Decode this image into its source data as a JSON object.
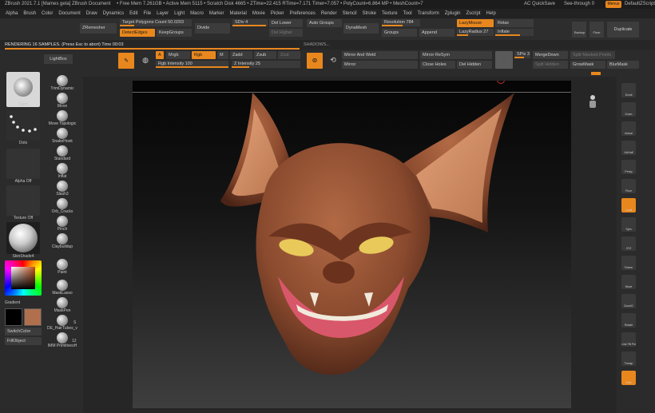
{
  "titlebar": {
    "app": "ZBrush 2021.7.1 [Mames geta]   ZBrush Document",
    "stats": "• Free Mem 7.261GB • Active Mem 5115 • Scratch Disk 4665 • ZTime=22.415 RTime=7.171 Timer=7.057 • PolyCount=6.864 MP • MeshCount=7",
    "ac": "AC",
    "quicksave": "QuickSave",
    "seethrough": "See-through  0",
    "menus": "Menus",
    "defaultscript": "DefaultZScript"
  },
  "menubar": [
    "Alpha",
    "Brush",
    "Color",
    "Document",
    "Draw",
    "Dynamics",
    "Edit",
    "File",
    "Layer",
    "Light",
    "Macro",
    "Marker",
    "Material",
    "Movie",
    "Picker",
    "Preferences",
    "Render",
    "Stencil",
    "Stroke",
    "Texture",
    "Tool",
    "Transform",
    "Zplugin",
    "Zscript",
    "Help"
  ],
  "toppalette": {
    "zremesher": "ZRemesher",
    "target_polys": "Target Polygons Count 50.0203",
    "detect_edges": "DetectEdges",
    "keep_groups": "KeepGroups",
    "divide": "Divide",
    "sdiv": "SDiv 4",
    "del_lower": "Del Lower",
    "del_higher": "Del Higher",
    "auto_groups": "Auto Groups",
    "dynamesh": "DynaMesh",
    "resolution": "Resolution 784",
    "groups": "Groups",
    "append": "Append",
    "lazymouse": "LazyMouse",
    "lazyradius": "LazyRadius 27",
    "relax": "Relax",
    "inflate": "Inflate",
    "backup": "Backup",
    "floor": "Floor",
    "duplicate": "Duplicate"
  },
  "render": {
    "status": "RENDERING 16 SAMPLES. (Press Esc to abort)  Time 00:03",
    "progress": 0.45
  },
  "shelf": {
    "lightbox": "LightBox",
    "a": "A",
    "mrgb": "Mrgb",
    "rgb": "Rgb",
    "m": "M",
    "zadd": "Zadd",
    "zsub": "Zsub",
    "zcut": "Zcut",
    "rgb_intensity": "Rgb Intensity 100",
    "z_intensity": "Z Intensity 25",
    "shadows": "SHADOWS...",
    "mirror_weld": "Mirror And Weld",
    "mirror": "Mirror",
    "resym": "Mirror ReSym",
    "close_holes": "Close Holes",
    "del_hidden": "Del Hidden",
    "spix": "SPix 3",
    "merge_down": "MergeDown",
    "split_hidden": "Split Hidden",
    "split_masked": "Split Masked Points",
    "grow_mask": "GrowMask",
    "blur_mask": "BlurMask"
  },
  "lefttray": {
    "paint": "Paint",
    "dots": "Dots",
    "alpha_off": "Alpha Off",
    "texture_off": "Texture Off",
    "skinshade": "SkinShade4",
    "gradient": "Gradient",
    "switchcolor": "SwitchColor",
    "fillobject": "FillObject",
    "brushes": [
      "TrimDynamic",
      "Move",
      "Move Topologic",
      "SnakeHook",
      "Standard",
      "Inflat",
      "Slash3",
      "Orb_Cracks",
      "Pinch",
      "Claybuildup",
      "Paint",
      "MaskLasso",
      "MaskPen",
      "DE_HairTubes_v",
      "IMM PrimitivesH"
    ],
    "count_s": "S",
    "count_12": "12",
    "colors": {
      "primary": "#000000",
      "secondary": "#b0704e"
    }
  },
  "righttray": [
    "Scroll",
    "Zoom",
    "Actual",
    "AAHalf",
    "Persp",
    "Floor",
    "Local",
    "Sym",
    "XYZ",
    "Frame",
    "Move",
    "ZoomD",
    "Rotate",
    "Line Fill PolyF",
    "Transp",
    "Solo"
  ],
  "colors": {
    "accent": "#e8871e",
    "bg": "#2a2a2a",
    "skin": "#8a4a2e"
  }
}
